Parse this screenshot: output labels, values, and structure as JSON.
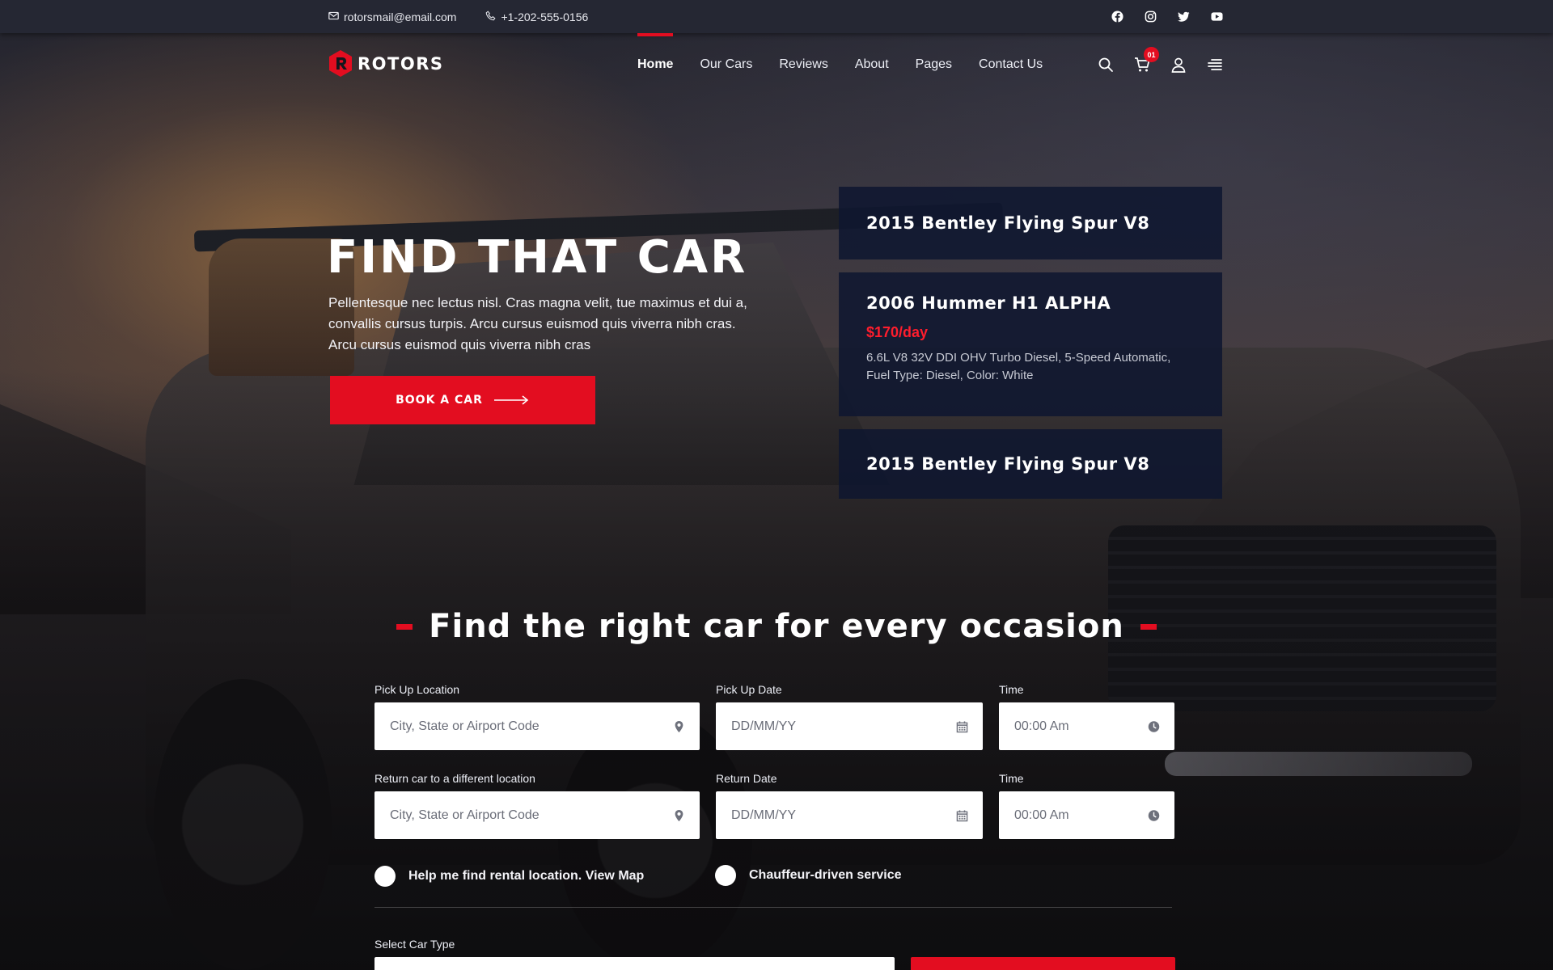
{
  "topbar": {
    "email": "rotorsmail@email.com",
    "phone": "+1-202-555-0156",
    "social": [
      "facebook-icon",
      "instagram-icon",
      "twitter-icon",
      "youtube-icon"
    ]
  },
  "brand": {
    "name": "ROTORS",
    "accent": "#e30d20"
  },
  "nav": {
    "items": [
      {
        "label": "Home",
        "active": true
      },
      {
        "label": "Our Cars"
      },
      {
        "label": "Reviews"
      },
      {
        "label": "About"
      },
      {
        "label": "Pages"
      },
      {
        "label": "Contact Us"
      }
    ],
    "cart_count": "01",
    "icons": [
      "search-icon",
      "cart-icon",
      "user-icon",
      "menu-icon"
    ]
  },
  "hero": {
    "title": "FIND THAT CAR",
    "text": "Pellentesque nec lectus nisl. Cras magna velit, tue maximus et dui a, convallis cursus turpis. Arcu cursus euismod quis viverra nibh cras. Arcu cursus euismod quis viverra nibh cras",
    "button": "BOOK A CAR"
  },
  "cars": [
    {
      "name": "2015 Bentley Flying Spur V8"
    },
    {
      "name": "2006 Hummer H1 ALPHA",
      "price": "$170/day",
      "desc": "6.6L V8 32V DDI OHV Turbo Diesel, 5-Speed Automatic, Fuel Type: Diesel, Color: White"
    },
    {
      "name": "2015 Bentley Flying Spur V8"
    }
  ],
  "form": {
    "title": "Find the right car for every occasion",
    "pickup_location_label": "Pick Up Location",
    "pickup_location_placeholder": "City, State or Airport Code",
    "pickup_date_label": "Pick Up Date",
    "pickup_date_placeholder": "DD/MM/YY",
    "pickup_time_label": "Time",
    "pickup_time_placeholder": "00:00 Am",
    "return_location_label": "Return car to a different location",
    "return_location_placeholder": "City, State or Airport Code",
    "return_date_label": "Return Date",
    "return_date_placeholder": "DD/MM/YY",
    "return_time_label": "Time",
    "return_time_placeholder": "00:00 Am",
    "option_map": "Help me find rental location. View Map",
    "option_chauffeur": "Chauffeur-driven service",
    "car_type_label": "Select Car Type"
  }
}
